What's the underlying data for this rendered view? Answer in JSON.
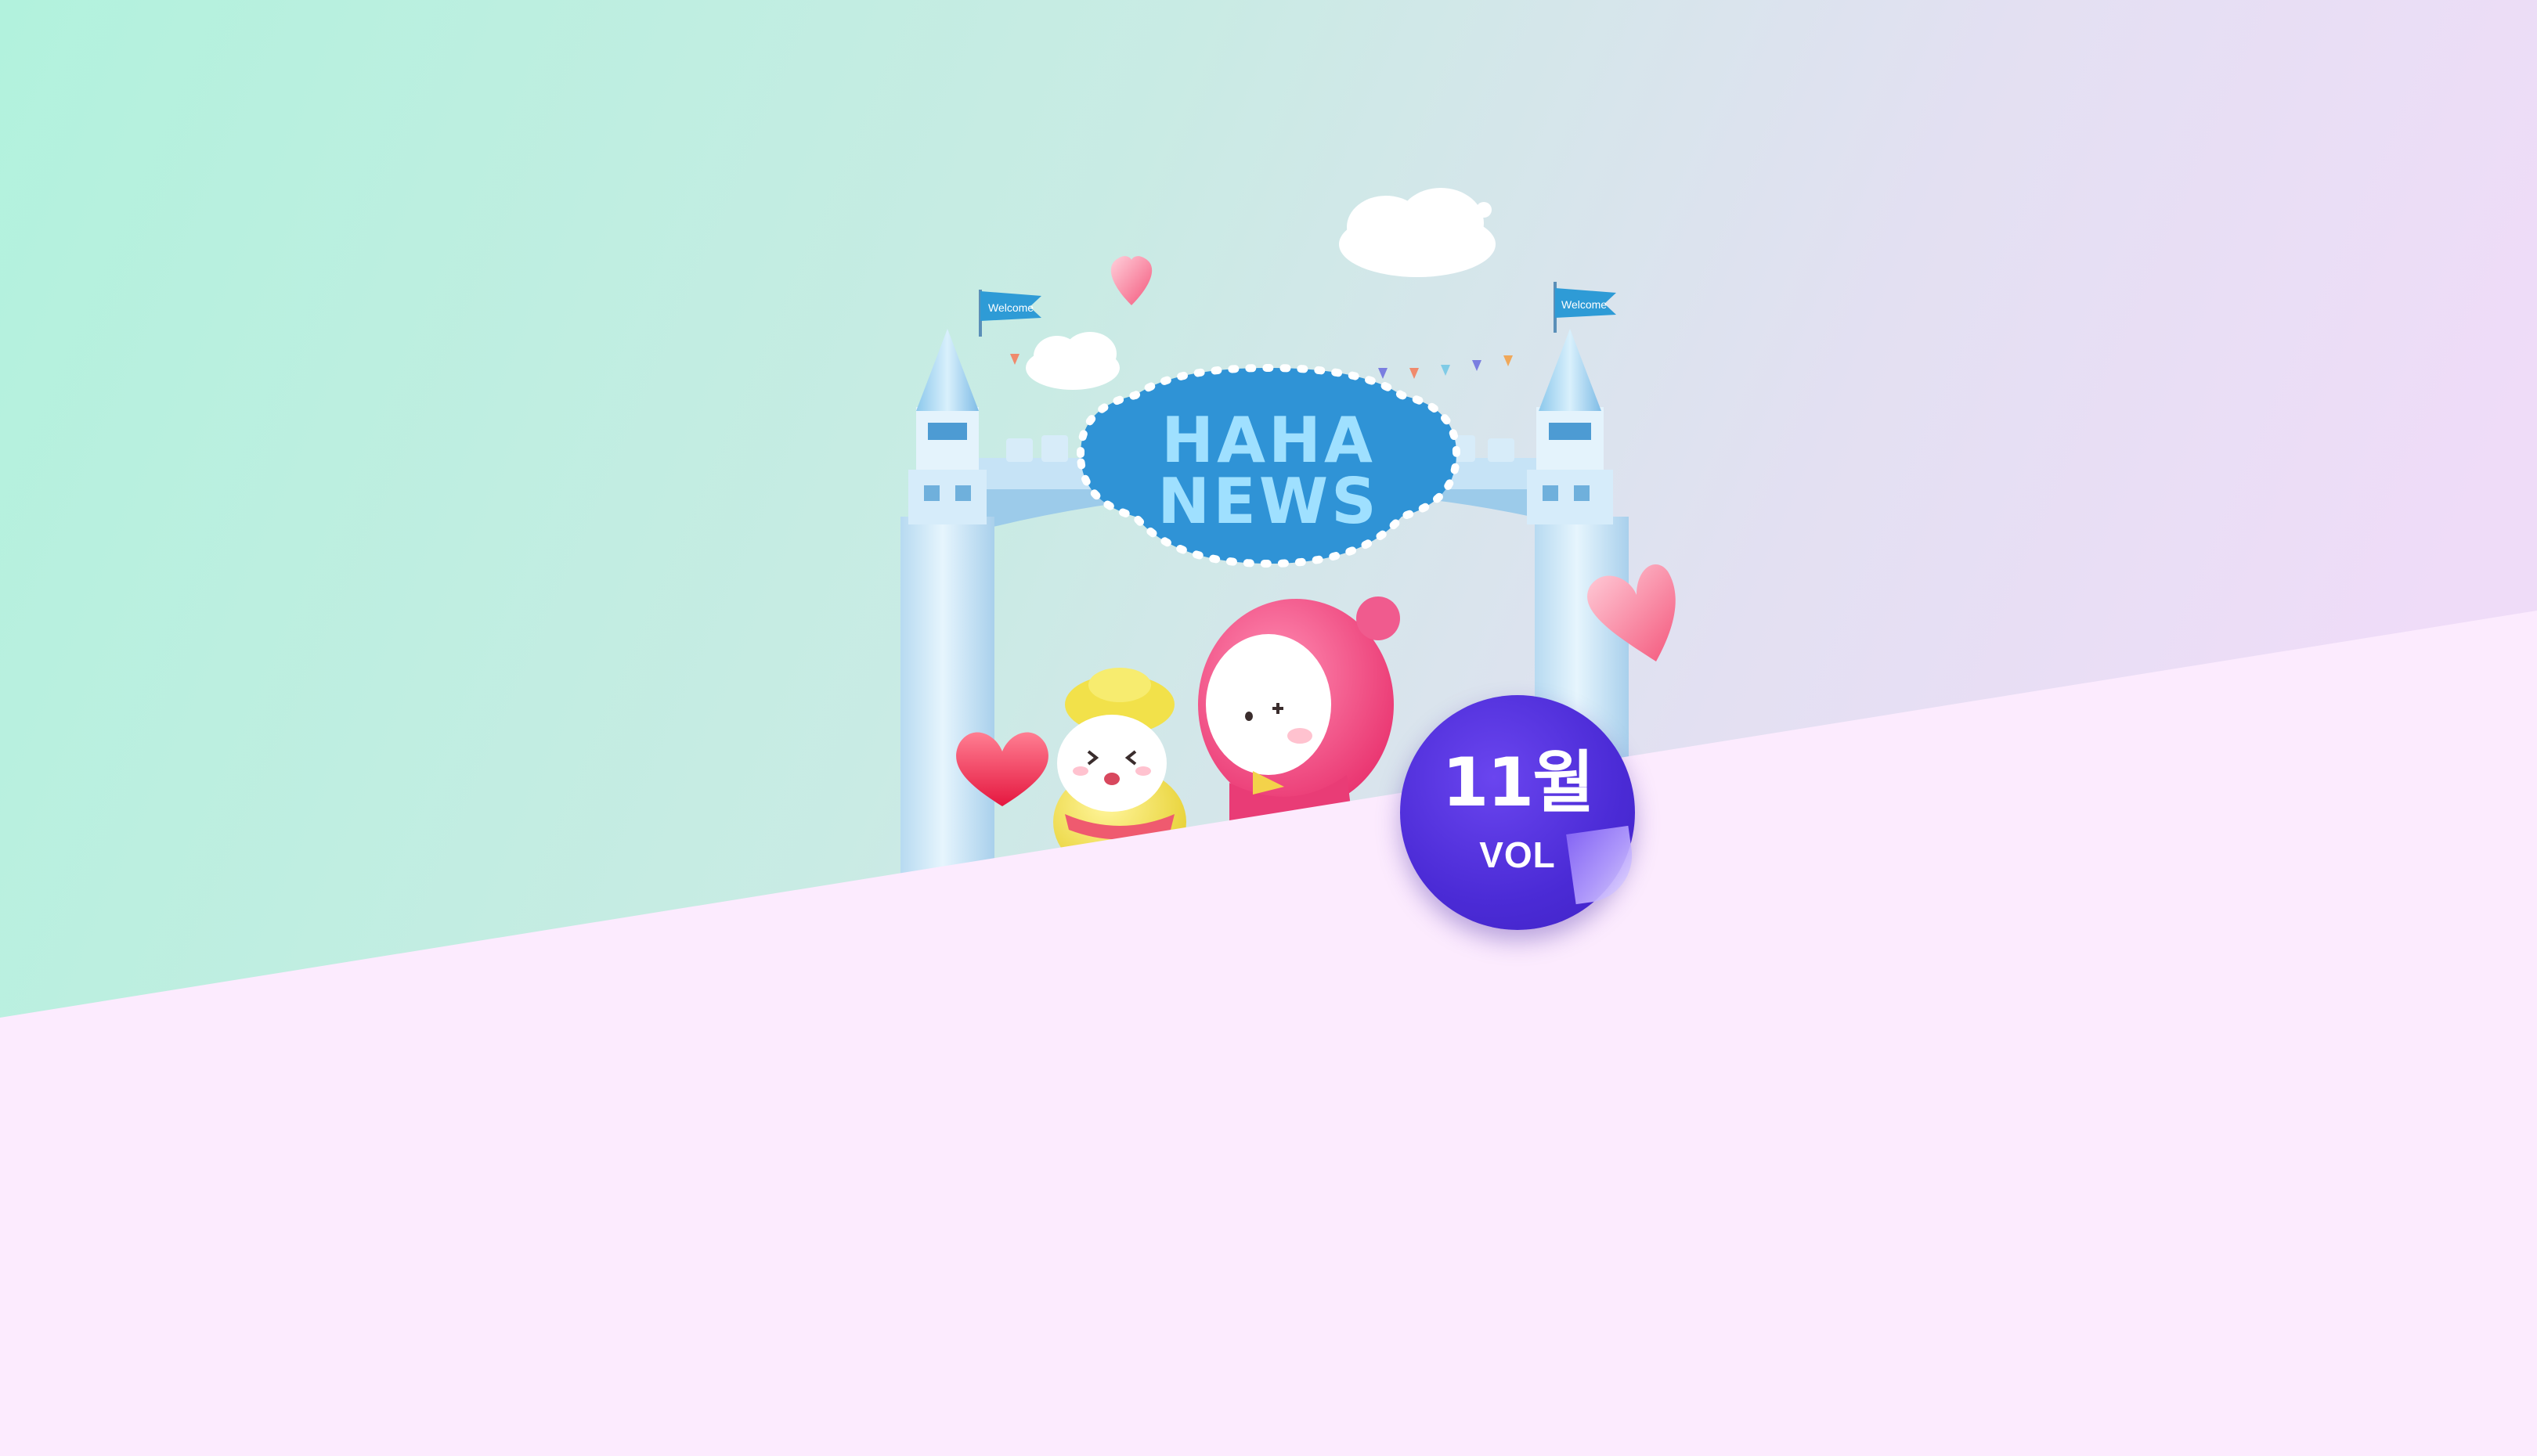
{
  "sign": {
    "line1": "HAHA",
    "line2": "NEWS"
  },
  "flags": {
    "left": "Welcome",
    "right": "Welcome"
  },
  "badge": {
    "month": "11월",
    "vol": "VOL"
  },
  "colors": {
    "bg_top_left": "#B4F1DF",
    "bg_top_right": "#EEDDF7",
    "bg_bottom": "#FCEAFE",
    "sign_blue": "#2F93D6",
    "sign_text": "#9FE0FF",
    "badge_purple": "#4F2EDC",
    "castle": "#CFE9F8",
    "pink_character": "#F2508A",
    "yellow_character": "#F3E24F",
    "heart_red": "#EE2A4D"
  },
  "icons": [
    "heart-icon",
    "cloud-icon",
    "flag-icon",
    "castle-tower-icon",
    "character-icon"
  ]
}
